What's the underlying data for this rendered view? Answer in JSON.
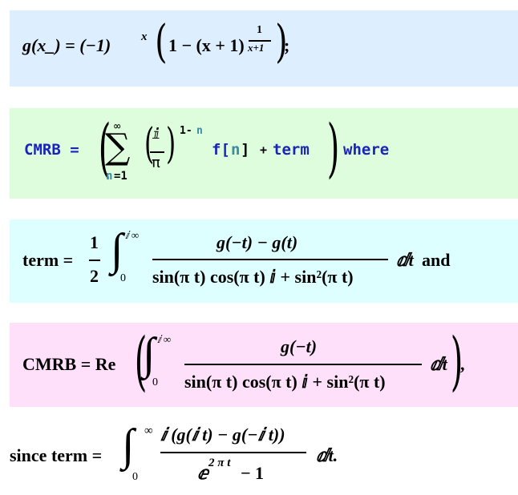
{
  "equations": {
    "g_def": {
      "lhs": "g(x_) = (−1)",
      "lhs_exp": "x",
      "one_minus": "1 − (x + 1)",
      "exp_num": "1",
      "exp_den": "x+1",
      "end": ";"
    },
    "cmrb_sum": {
      "lhs": "CMRB =",
      "sum_upper": "∞",
      "sum_symbol": "∑",
      "sum_lower_var": "n",
      "sum_lower_eq": "=1",
      "frac_num": "ⅈ",
      "frac_den": "π",
      "exp_prefix": "1-",
      "exp_var": "n",
      "f_name": "f[",
      "f_var": "n",
      "f_close": "]",
      "plus": "+",
      "term": "term",
      "where": "where"
    },
    "term_def": {
      "lhs": "term =",
      "half_num": "1",
      "half_den": "2",
      "int_upper": "ⅈ ∞",
      "int_lower": "0",
      "numerator": "g(−t) − g(t)",
      "denominator": "sin(π t) cos(π t) ⅈ +  sin²(π t)",
      "dt": "ⅆt",
      "and": "and"
    },
    "cmrb_re": {
      "lhs": "CMRB = Re",
      "int_upper": "ⅈ ∞",
      "int_lower": "0",
      "numerator": "g(−t)",
      "denominator": "sin(π t) cos(π t) ⅈ +  sin²(π t)",
      "dt": "ⅆt",
      "end": ","
    },
    "since_term": {
      "lhs": "since term =",
      "int_upper": "∞",
      "int_lower": "0",
      "numerator": "ⅈ (g(ⅈ t) − g(−ⅈ t))",
      "den_base": "ⅇ",
      "den_exp": "2 π t",
      "den_rest": " − 1",
      "dt": "ⅆt."
    }
  },
  "colors": {
    "box1": "#ddeeff",
    "box2": "#ddfddd",
    "box3": "#ddffff",
    "box4": "#ffe0fb",
    "code_blue": "#1a24b8",
    "code_teal": "#3a8aa0"
  }
}
